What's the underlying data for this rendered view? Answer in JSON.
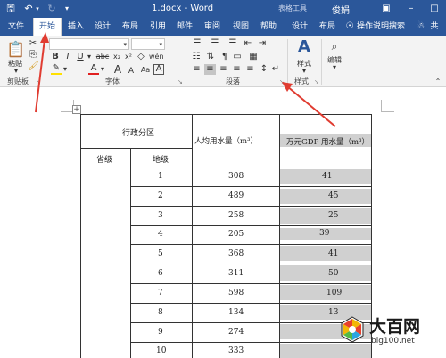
{
  "titlebar": {
    "title": "1.docx - Word",
    "context_tools": "表格工具",
    "user": "俊娟",
    "qat_icons": [
      "save-icon",
      "undo-icon",
      "undo-dropdown-icon",
      "redo-icon",
      "customize-qat-icon"
    ],
    "window_icons": [
      "ribbon-display-icon",
      "minimize-icon",
      "restore-icon"
    ]
  },
  "tabs": [
    {
      "label": "文件"
    },
    {
      "label": "开始"
    },
    {
      "label": "插入"
    },
    {
      "label": "设计"
    },
    {
      "label": "布局"
    },
    {
      "label": "引用"
    },
    {
      "label": "邮件"
    },
    {
      "label": "审阅"
    },
    {
      "label": "视图"
    },
    {
      "label": "帮助"
    },
    {
      "label": "设计"
    },
    {
      "label": "布局"
    }
  ],
  "tell_me": "操作说明搜索",
  "share": "共",
  "ribbon": {
    "clipboard": {
      "label": "剪贴板",
      "paste": "粘贴"
    },
    "font": {
      "label": "字体",
      "font_name": "",
      "font_size": "",
      "wen": "wén",
      "a_large": "A",
      "a_small": "A",
      "clear": "A",
      "aa": "Aa",
      "char_border": "A"
    },
    "paragraph": {
      "label": "段落"
    },
    "styles": {
      "label": "样式",
      "button": "样式"
    },
    "editing": {
      "button": "编辑"
    }
  },
  "active_tab_index": 1,
  "table": {
    "header_region": "行政分区",
    "header_per_capita": "人均用水量（m³）",
    "header_gdp": "万元GDP 用水量（m³）",
    "sub_province": "省级",
    "sub_prefecture": "地级",
    "rows": [
      {
        "id": "1",
        "per_capita": "308",
        "gdp": "41"
      },
      {
        "id": "2",
        "per_capita": "489",
        "gdp": "45"
      },
      {
        "id": "3",
        "per_capita": "258",
        "gdp": "25"
      },
      {
        "id": "4",
        "per_capita": "205",
        "gdp": "39"
      },
      {
        "id": "5",
        "per_capita": "368",
        "gdp": "41"
      },
      {
        "id": "6",
        "per_capita": "311",
        "gdp": "50"
      },
      {
        "id": "7",
        "per_capita": "598",
        "gdp": "109"
      },
      {
        "id": "8",
        "per_capita": "134",
        "gdp": "13"
      },
      {
        "id": "9",
        "per_capita": "274",
        "gdp": ""
      },
      {
        "id": "10",
        "per_capita": "333",
        "gdp": ""
      }
    ]
  },
  "watermark": {
    "name": "大百网",
    "url": "big100.net"
  },
  "colors": {
    "ribbon_blue": "#2b579a",
    "arrow_red": "#e03c31",
    "cell_shade": "#d0d0d0"
  }
}
